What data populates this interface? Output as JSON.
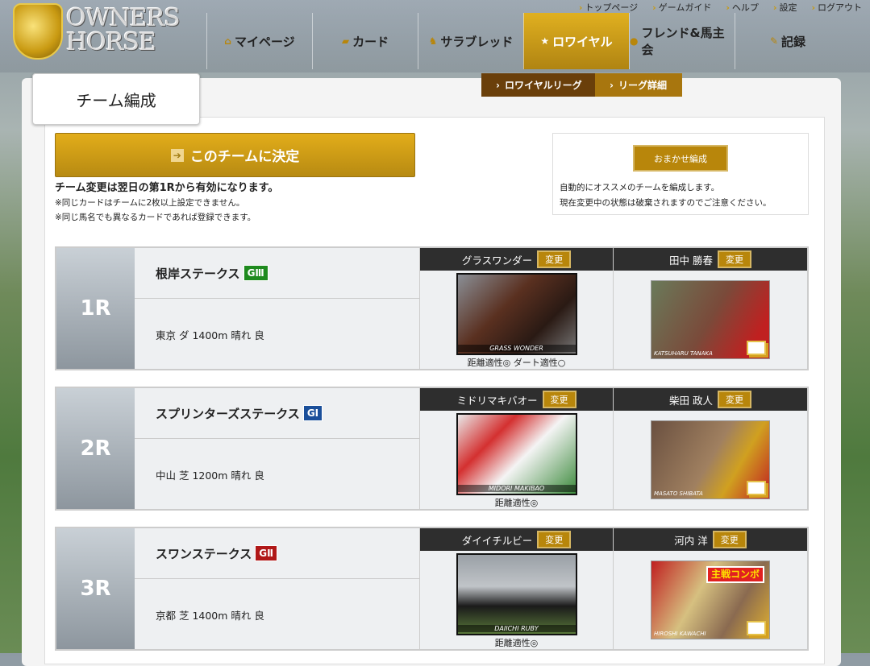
{
  "logo": {
    "line1": "OWNERS",
    "line2": "HORSE"
  },
  "top_links": [
    "トップページ",
    "ゲームガイド",
    "ヘルプ",
    "設定",
    "ログアウト"
  ],
  "nav": [
    {
      "label": "マイページ",
      "icon": "home-icon"
    },
    {
      "label": "カード",
      "icon": "card-icon"
    },
    {
      "label": "サラブレッド",
      "icon": "horse-icon"
    },
    {
      "label": "ロワイヤル",
      "icon": "star-icon",
      "active": true
    },
    {
      "label": "フレンド&馬主会",
      "icon": "chat-icon"
    },
    {
      "label": "記録",
      "icon": "pencil-icon"
    }
  ],
  "subnav": [
    "ロワイヤルリーグ",
    "リーグ詳細"
  ],
  "page_title": "チーム編成",
  "decide_button": "このチームに決定",
  "notes": [
    "チーム変更は翌日の第1Rから有効になります。",
    "※同じカードはチームに2枚以上設定できません。",
    "※同じ馬名でも異なるカードであれば登録できます。"
  ],
  "auto": {
    "button": "おまかせ編成",
    "lines": [
      "自動的にオススメのチームを編成します。",
      "現在変更中の状態は破棄されますのでご注意ください。"
    ]
  },
  "change_label": "変更",
  "races": [
    {
      "label": "1R",
      "name": "根岸ステークス",
      "grade": "GⅢ",
      "grade_color": "#1e8a1e",
      "conditions": "東京 ダ 1400m 晴れ 良",
      "horse": "グラスワンダー",
      "horse_card": "GRASS WONDER",
      "aptitude": "距離適性◎ ダート適性○",
      "jockey": "田中 勝春",
      "jockey_card": "KATSUHARU TANAKA"
    },
    {
      "label": "2R",
      "name": "スプリンターズステークス",
      "grade": "GⅠ",
      "grade_color": "#1a4f9a",
      "conditions": "中山 芝 1200m 晴れ 良",
      "horse": "ミドリマキバオー",
      "horse_card": "MIDORI MAKIBAO",
      "aptitude": "距離適性◎",
      "jockey": "柴田 政人",
      "jockey_card": "MASATO SHIBATA"
    },
    {
      "label": "3R",
      "name": "スワンステークス",
      "grade": "GⅡ",
      "grade_color": "#b01818",
      "conditions": "京都 芝 1400m 晴れ 良",
      "horse": "ダイイチルビー",
      "horse_card": "DAIICHI RUBY",
      "aptitude": "距離適性◎",
      "jockey": "河内 洋",
      "jockey_card": "HIROSHI KAWACHI",
      "jockey_badge": "主戦コンボ"
    }
  ]
}
